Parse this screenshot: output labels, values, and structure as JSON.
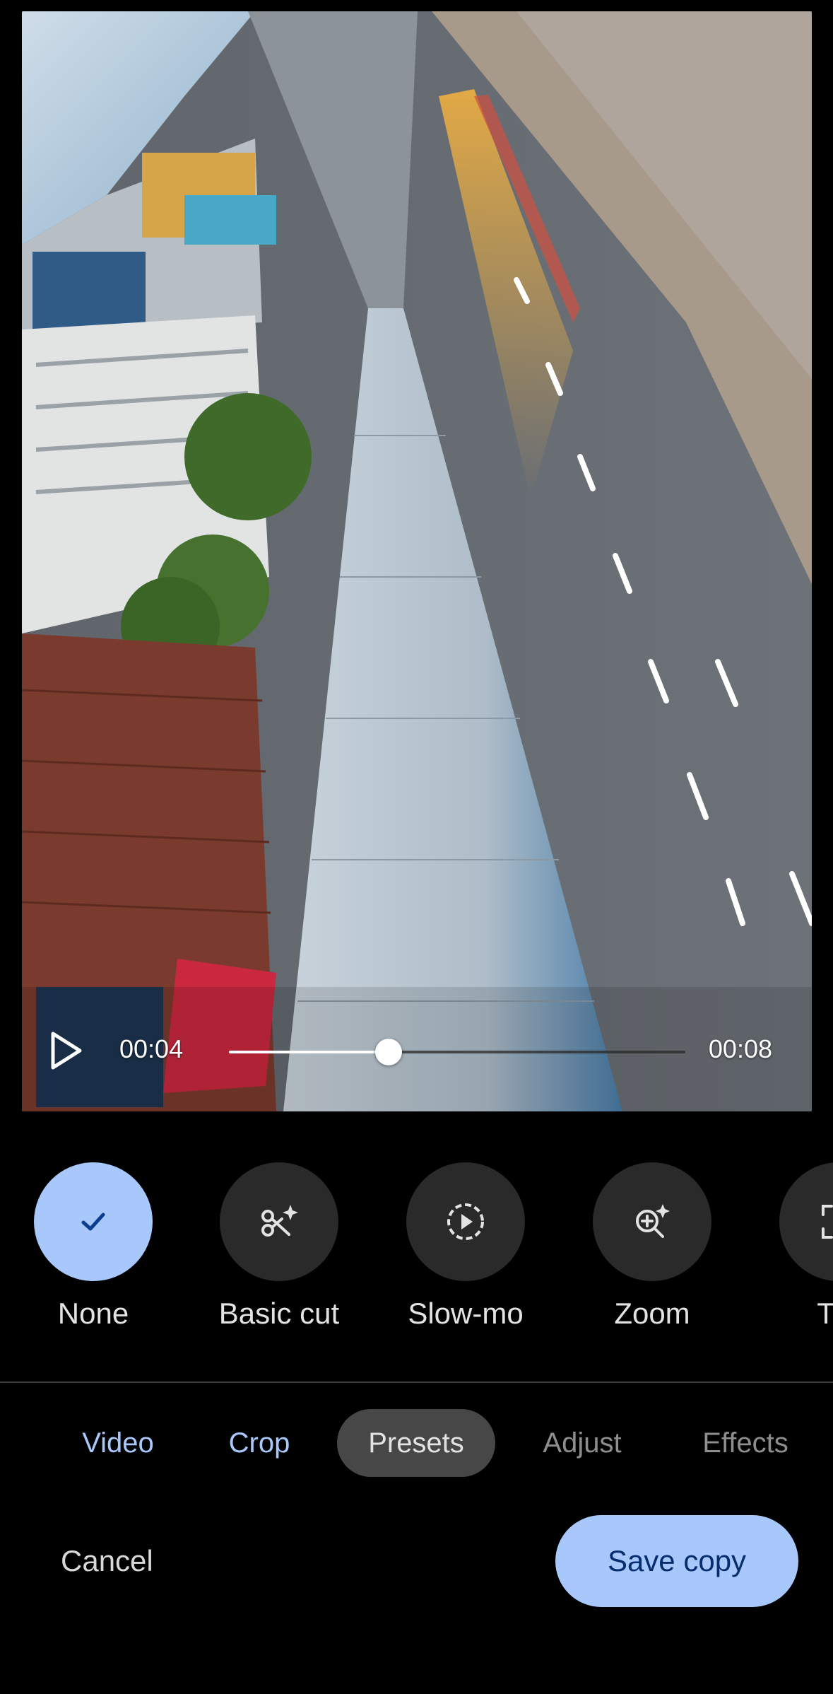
{
  "player": {
    "current_time": "00:04",
    "duration": "00:08",
    "progress": 0.35,
    "play_icon": "play-icon"
  },
  "presets": [
    {
      "label": "None",
      "icon": "check-icon",
      "selected": true
    },
    {
      "label": "Basic cut",
      "icon": "scissors-sparkle-icon",
      "selected": false
    },
    {
      "label": "Slow-mo",
      "icon": "slow-motion-icon",
      "selected": false
    },
    {
      "label": "Zoom",
      "icon": "zoom-sparkle-icon",
      "selected": false
    },
    {
      "label": "Tra",
      "icon": "track-icon",
      "selected": false
    }
  ],
  "tabs": [
    {
      "label": "Video",
      "state": "enabled"
    },
    {
      "label": "Crop",
      "state": "enabled"
    },
    {
      "label": "Presets",
      "state": "active"
    },
    {
      "label": "Adjust",
      "state": "disabled"
    },
    {
      "label": "Effects",
      "state": "disabled"
    }
  ],
  "actions": {
    "cancel_label": "Cancel",
    "save_label": "Save copy"
  },
  "colors": {
    "accent": "#a8c7fa",
    "background": "#000000",
    "active_tab_bg": "#474747"
  }
}
